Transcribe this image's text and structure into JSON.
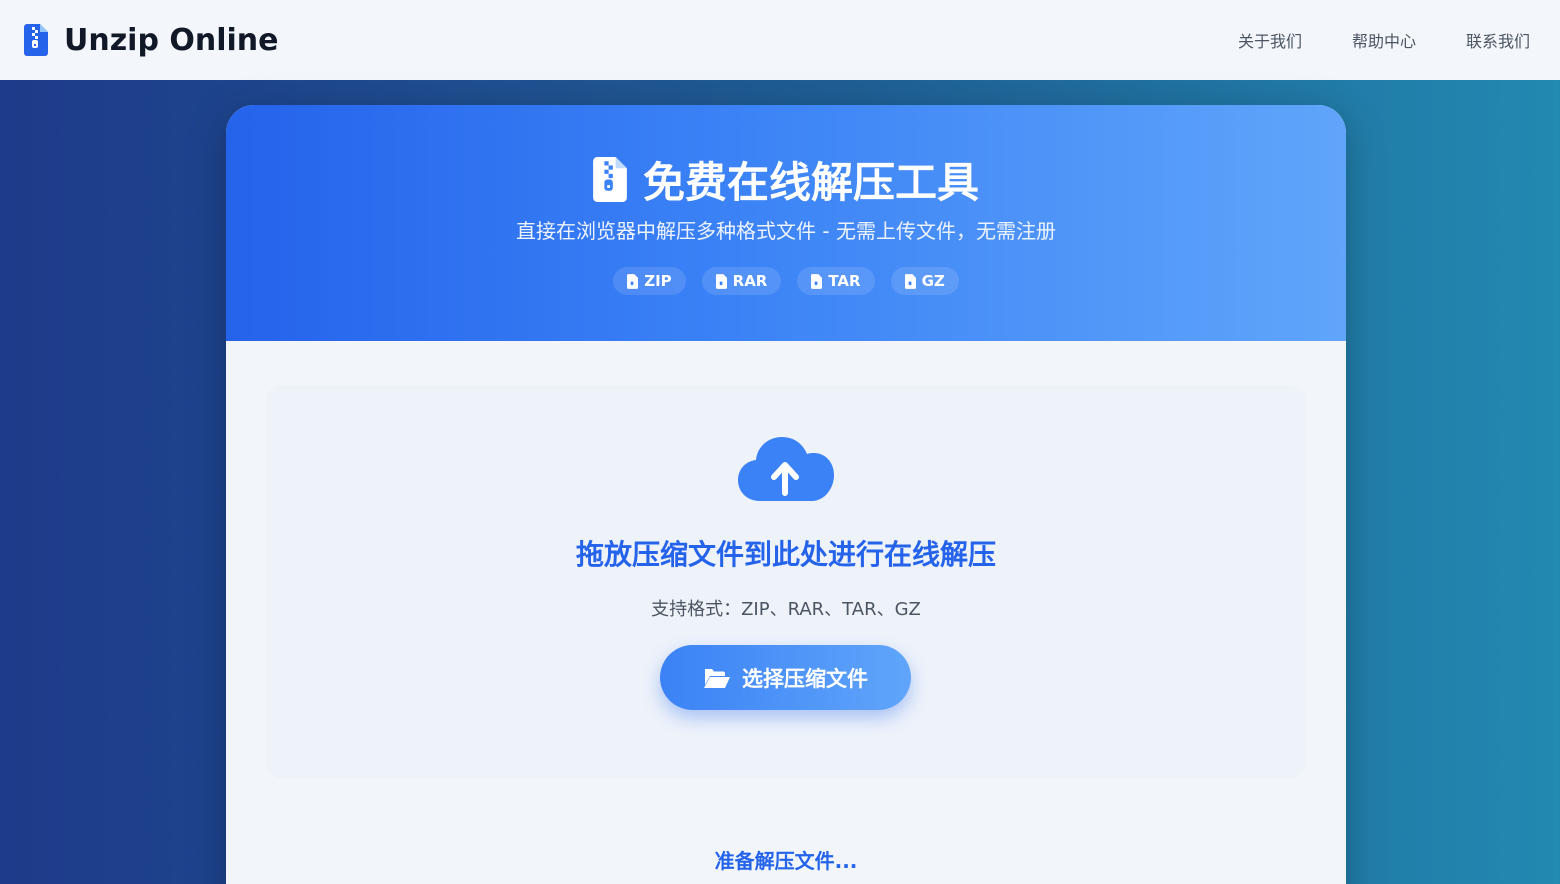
{
  "navbar": {
    "brand": "Unzip Online",
    "brand_icon": "zip-file-icon",
    "links": [
      "关于我们",
      "帮助中心",
      "联系我们"
    ]
  },
  "hero": {
    "icon": "zip-file-icon",
    "title": "免费在线解压工具",
    "subtitle": "直接在浏览器中解压多种格式文件 - 无需上传文件，无需注册",
    "formats": [
      "ZIP",
      "RAR",
      "TAR",
      "GZ"
    ]
  },
  "dropzone": {
    "icon": "cloud-upload-icon",
    "title": "拖放压缩文件到此处进行在线解压",
    "subtitle": "支持格式：ZIP、RAR、TAR、GZ",
    "button_label": "选择压缩文件",
    "button_icon": "folder-open-icon"
  },
  "status": {
    "text": "准备解压文件..."
  },
  "colors": {
    "accent": "#2563eb",
    "accent_light": "#60a5fa",
    "nav_bg": "#f3f6fa",
    "bg_left": "#1e3a8a",
    "bg_right": "#2289b1"
  }
}
